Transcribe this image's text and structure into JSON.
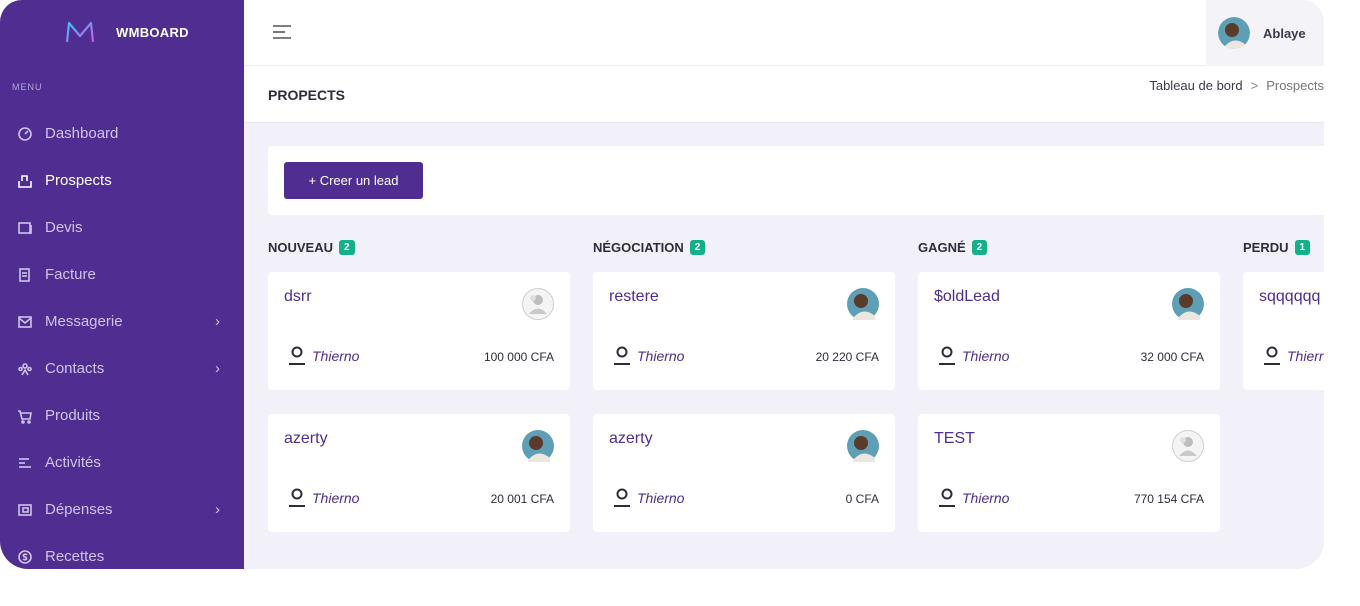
{
  "brand": {
    "name": "WMBOARD"
  },
  "sidebar": {
    "menu_title": "MENU",
    "items": [
      {
        "label": "Dashboard",
        "icon": "dashboard-icon",
        "active": false,
        "chevron": false
      },
      {
        "label": "Prospects",
        "icon": "prospects-icon",
        "active": true,
        "chevron": false
      },
      {
        "label": "Devis",
        "icon": "devis-icon",
        "active": false,
        "chevron": false
      },
      {
        "label": "Facture",
        "icon": "facture-icon",
        "active": false,
        "chevron": false
      },
      {
        "label": "Messagerie",
        "icon": "mail-icon",
        "active": false,
        "chevron": true
      },
      {
        "label": "Contacts",
        "icon": "contacts-icon",
        "active": false,
        "chevron": true
      },
      {
        "label": "Produits",
        "icon": "cart-icon",
        "active": false,
        "chevron": false
      },
      {
        "label": "Activités",
        "icon": "activities-icon",
        "active": false,
        "chevron": false
      },
      {
        "label": "Dépenses",
        "icon": "expenses-icon",
        "active": false,
        "chevron": true
      },
      {
        "label": "Recettes",
        "icon": "revenue-icon",
        "active": false,
        "chevron": false
      }
    ]
  },
  "header": {
    "user_name": "Ablaye"
  },
  "page": {
    "title": "PROPECTS",
    "breadcrumb": {
      "home": "Tableau de bord",
      "separator": ">",
      "current": "Prospects"
    }
  },
  "actions": {
    "create_label": "+  Creer un lead"
  },
  "columns": [
    {
      "title": "NOUVEAU",
      "count": "2",
      "cards": [
        {
          "title": "dsrr",
          "owner": "Thierno",
          "amount": "100 000 CFA",
          "avatar": "default"
        },
        {
          "title": "azerty",
          "owner": "Thierno",
          "amount": "20 001 CFA",
          "avatar": "photo"
        }
      ]
    },
    {
      "title": "NÉGOCIATION",
      "count": "2",
      "cards": [
        {
          "title": "restere",
          "owner": "Thierno",
          "amount": "20 220 CFA",
          "avatar": "photo"
        },
        {
          "title": "azerty",
          "owner": "Thierno",
          "amount": "0 CFA",
          "avatar": "photo"
        }
      ]
    },
    {
      "title": "GAGNÉ",
      "count": "2",
      "cards": [
        {
          "title": "$oldLead",
          "owner": "Thierno",
          "amount": "32 000 CFA",
          "avatar": "photo"
        },
        {
          "title": "TEST",
          "owner": "Thierno",
          "amount": "770 154 CFA",
          "avatar": "default"
        }
      ]
    },
    {
      "title": "PERDU",
      "count": "1",
      "cards": [
        {
          "title": "sqqqqqq",
          "owner": "Thierno",
          "amount": "",
          "avatar": "photo"
        }
      ]
    }
  ],
  "colors": {
    "primary": "#4f2d91",
    "badge": "#13b08a",
    "background": "#f2f0f9"
  }
}
